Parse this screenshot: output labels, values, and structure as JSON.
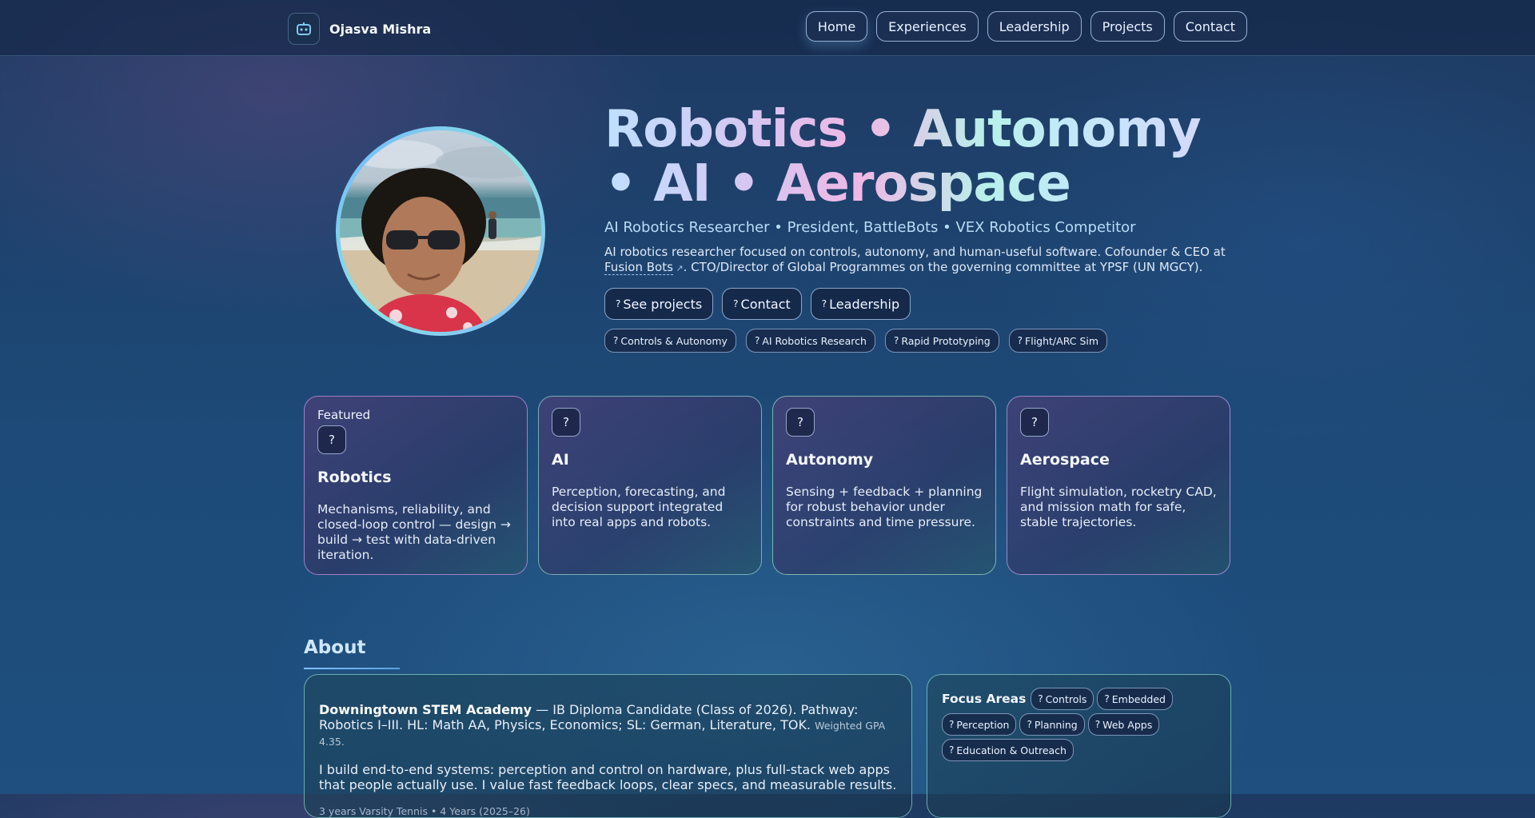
{
  "header": {
    "brand_name": "Ojasva Mishra",
    "brand_icon": "robot-icon",
    "nav": [
      {
        "label": "Home",
        "active": true
      },
      {
        "label": "Experiences"
      },
      {
        "label": "Leadership"
      },
      {
        "label": "Projects"
      },
      {
        "label": "Contact"
      }
    ]
  },
  "hero": {
    "title": "Robotics • Autonomy • AI • Aerospace",
    "subtitle": "AI Robotics Researcher • President, BattleBots • VEX Robotics Competitor",
    "desc_part1": "AI robotics researcher focused on controls, autonomy, and human-useful software. Cofounder & CEO at ",
    "desc_link": "Fusion Bots",
    "desc_part2": ". CTO/Director of Global Programmes on the governing committee at YPSF (UN MGCY).",
    "actions": [
      "See projects",
      "Contact",
      "Leadership"
    ],
    "chips": [
      "Controls & Autonomy",
      "AI Robotics Research",
      "Rapid Prototyping",
      "Flight/ARC Sim"
    ],
    "glyph": "?"
  },
  "cards": [
    {
      "featured": "Featured",
      "title": "Robotics",
      "text": "Mechanisms, reliability, and closed-loop control — design → build → test with data-driven iteration."
    },
    {
      "title": "AI",
      "text": "Perception, forecasting, and decision support integrated into real apps and robots."
    },
    {
      "title": "Autonomy",
      "text": "Sensing + feedback + planning for robust behavior under constraints and time pressure."
    },
    {
      "title": "Aerospace",
      "text": "Flight simulation, rocketry CAD, and mission math for safe, stable trajectories."
    }
  ],
  "about": {
    "heading": "About",
    "school": "Downingtown STEM Academy",
    "school_rest": " — IB Diploma Candidate (Class of 2026). Pathway: Robotics I–III. HL: Math AA, Physics, Economics; SL: German, Literature, TOK. ",
    "gpa": "Weighted GPA 4.35.",
    "p2": "I build end-to-end systems: perception and control on hardware, plus full-stack web apps that people actually use. I value fast feedback loops, clear specs, and measurable results.",
    "p3": "3 years Varsity Tennis • 4 Years (2025–26)"
  },
  "focus": {
    "title": "Focus Areas",
    "chips": [
      "Controls",
      "Embedded",
      "Perception",
      "Planning",
      "Web Apps",
      "Education & Outreach"
    ]
  }
}
